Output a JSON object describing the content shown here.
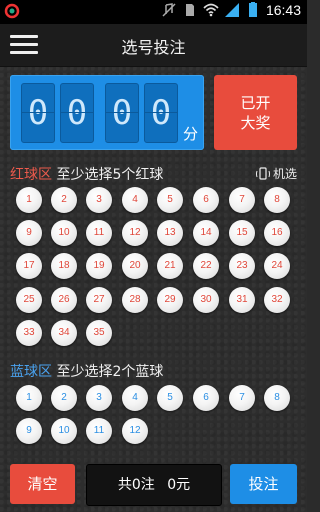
{
  "status_bar": {
    "time": "16:43"
  },
  "header": {
    "title": "选号投注"
  },
  "timer": {
    "digits": [
      "0",
      "0",
      "0",
      "0"
    ],
    "unit": "分"
  },
  "opened_button": {
    "line1": "已开",
    "line2": "大奖"
  },
  "red_section": {
    "title_colored": "红球区",
    "title_rest": "至少选择5个红球",
    "machine_pick": "机选",
    "balls": [
      "1",
      "2",
      "3",
      "4",
      "5",
      "6",
      "7",
      "8",
      "9",
      "10",
      "11",
      "12",
      "13",
      "14",
      "15",
      "16",
      "17",
      "18",
      "19",
      "20",
      "21",
      "22",
      "23",
      "24",
      "25",
      "26",
      "27",
      "28",
      "29",
      "30",
      "31",
      "32",
      "33",
      "34",
      "35"
    ]
  },
  "blue_section": {
    "title_colored": "蓝球区",
    "title_rest": "至少选择2个蓝球",
    "balls": [
      "1",
      "2",
      "3",
      "4",
      "5",
      "6",
      "7",
      "8",
      "9",
      "10",
      "11",
      "12"
    ]
  },
  "bottom": {
    "clear_label": "清空",
    "summary_notes": "共0注",
    "summary_amount": "0元",
    "submit_label": "投注"
  },
  "colors": {
    "accent_blue": "#1e8ee6",
    "accent_red": "#e84c3d"
  }
}
